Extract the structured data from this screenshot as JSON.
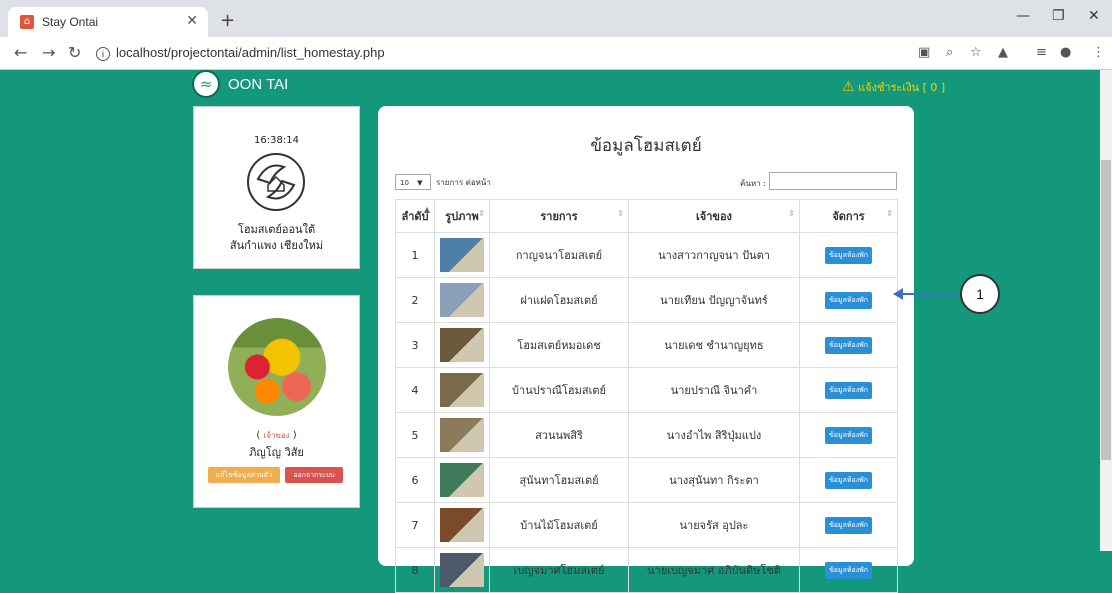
{
  "browser": {
    "tab_title": "Stay Ontai",
    "url": "localhost/projectontai/admin/list_homestay.php"
  },
  "header": {
    "brand": "OON TAI",
    "alert_text": "แจ้งชำระเงิน [ 0 ]"
  },
  "info_panel": {
    "clock": "16:38:14",
    "name_line1": "โฮมสเตย์ออนใต้",
    "name_line2": "สันกำแพง เชียงใหม่"
  },
  "user_panel": {
    "role": "เจ้าของ",
    "role_open": "( ",
    "role_close": " )",
    "user_name": "ภิญโญ วิสัย",
    "edit_button": "แก้ไขข้อมูลส่วนตัว",
    "logout_button": "ออกจากระบบ"
  },
  "main": {
    "title": "ข้อมูลโฮมสเตย์",
    "page_length": "10",
    "page_length_label": "รายการ ต่อหน้า",
    "search_label": "ค้นหา :",
    "search_value": "",
    "columns": [
      "ลำดับ",
      "รูปภาพ",
      "รายการ",
      "เจ้าของ",
      "จัดการ"
    ],
    "detail_button": "ข้อมูลห้องพัก",
    "rows": [
      {
        "no": "1",
        "name": "กาญจนาโฮมสเตย์",
        "owner": "นางสาวกาญจนา ปันตา",
        "img": "#4a7fa8"
      },
      {
        "no": "2",
        "name": "ฝาแฝดโฮมสเตย์",
        "owner": "นายเทียน ปัญญาจันทร์",
        "img": "#8aa0b8"
      },
      {
        "no": "3",
        "name": "โฮมสเตย์หมอเดช",
        "owner": "นายเดช ชำนาญยุทธ",
        "img": "#6b5a3a"
      },
      {
        "no": "4",
        "name": "บ้านปราณีโฮมสเตย์",
        "owner": "นายปราณี จินาคำ",
        "img": "#7b6a4a"
      },
      {
        "no": "5",
        "name": "สวนนพสิริ",
        "owner": "นางอำไพ สิริปุ่มแปง",
        "img": "#8a7a5a"
      },
      {
        "no": "6",
        "name": "สุนันทาโฮมสเตย์",
        "owner": "นางสุนันทา กิระตา",
        "img": "#3f7a5a"
      },
      {
        "no": "7",
        "name": "บ้านไม้โฮมสเตย์",
        "owner": "นายจรัส อุปละ",
        "img": "#7a4a2a"
      },
      {
        "no": "8",
        "name": "เบญจมาศโฮมสเตย์",
        "owner": "นายเบญจมาศ อภิบันดิษโชติ",
        "img": "#4a5a6a"
      }
    ]
  },
  "callout": "1"
}
